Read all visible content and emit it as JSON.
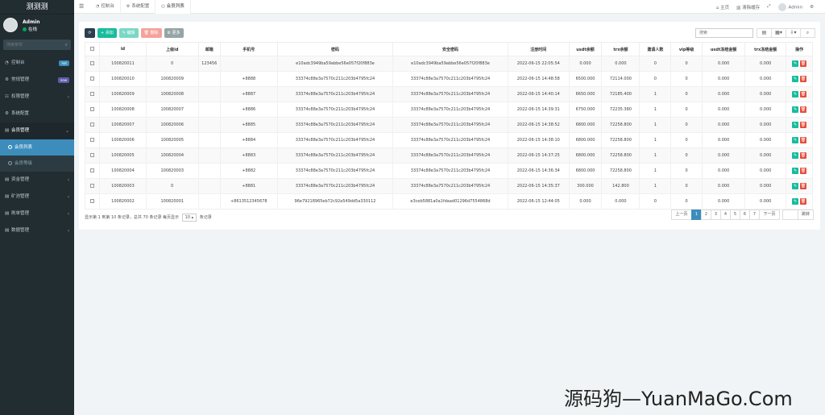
{
  "sidebar": {
    "brand": "测测测",
    "user_name": "Admin",
    "user_status": "在线",
    "search_placeholder": "搜索菜单",
    "menu": [
      {
        "label": "控制台",
        "badge": "hot",
        "badge_color": "#3c8dbc"
      },
      {
        "label": "常规管理",
        "badge": "new",
        "badge_color": "#605ca8"
      },
      {
        "label": "权限管理",
        "arrow": "‹"
      },
      {
        "label": "系统配置"
      },
      {
        "label": "会员管理",
        "arrow": "‹"
      }
    ],
    "submenu": [
      {
        "label": "会员列表"
      },
      {
        "label": "会员等级"
      }
    ],
    "menu2": [
      {
        "label": "资金管理",
        "arrow": "‹"
      },
      {
        "label": "矿池管理",
        "arrow": "‹"
      },
      {
        "label": "刷单管理",
        "arrow": "‹"
      },
      {
        "label": "数据管理",
        "arrow": "‹"
      }
    ]
  },
  "topbar": {
    "tabs": [
      {
        "label": "控制台",
        "icon": "dashboard-icon"
      },
      {
        "label": "系统配置",
        "icon": "gear-icon"
      },
      {
        "label": "会员列表",
        "icon": "circle-icon"
      }
    ],
    "home": "主页",
    "clear_cache": "清除缓存",
    "admin": "Admin"
  },
  "toolbar": {
    "add": "+ 添加",
    "edit": "✎ 编辑",
    "delete": "🗑 删除",
    "more": "⚙ 更多",
    "search_placeholder": "搜索"
  },
  "table": {
    "headers": [
      "id",
      "上级id",
      "邮箱",
      "手机号",
      "密码",
      "安全密码",
      "注册时间",
      "usdt余额",
      "trx余额",
      "邀请人数",
      "vip等级",
      "usdt冻结金额",
      "trx冻结金额",
      "操作"
    ],
    "rows": [
      [
        "100820011",
        "0",
        "123456",
        "",
        "e10adc3949ba59abbe56e057f20f883e",
        "e10adc3949ba59abbe56e057f20f883e",
        "2022-06-15 22:05:54",
        "0.000",
        "0.000",
        "0",
        "0",
        "0.000",
        "0.000"
      ],
      [
        "100820010",
        "100820009",
        "",
        "+8888",
        "33374c88e3a7570c211c203b4795fc24",
        "33374c88e3a7570c211c203b4795fc24",
        "2022-06-15 14:48:58",
        "6500.000",
        "72114.000",
        "0",
        "0",
        "0.000",
        "0.000"
      ],
      [
        "100820009",
        "100820008",
        "",
        "+8887",
        "33374c88e3a7570c211c203b4795fc24",
        "33374c88e3a7570c211c203b4795fc24",
        "2022-06-15 14:40:14",
        "6650.000",
        "72185.400",
        "1",
        "0",
        "0.000",
        "0.000"
      ],
      [
        "100820008",
        "100820007",
        "",
        "+8886",
        "33374c88e3a7570c211c203b4795fc24",
        "33374c88e3a7570c211c203b4795fc24",
        "2022-06-15 14:39:31",
        "6750.000",
        "72235.380",
        "1",
        "0",
        "0.000",
        "0.000"
      ],
      [
        "100820007",
        "100820006",
        "",
        "+8885",
        "33374c88e3a7570c211c203b4795fc24",
        "33374c88e3a7570c211c203b4795fc24",
        "2022-06-15 14:38:52",
        "6800.000",
        "72258.800",
        "1",
        "0",
        "0.000",
        "0.000"
      ],
      [
        "100820006",
        "100820005",
        "",
        "+8884",
        "33374c88e3a7570c211c203b4795fc24",
        "33374c88e3a7570c211c203b4795fc24",
        "2022-06-15 14:38:10",
        "6800.000",
        "72258.800",
        "1",
        "0",
        "0.000",
        "0.000"
      ],
      [
        "100820005",
        "100820004",
        "",
        "+8883",
        "33374c88e3a7570c211c203b4795fc24",
        "33374c88e3a7570c211c203b4795fc24",
        "2022-06-15 14:37:25",
        "6800.000",
        "72258.800",
        "1",
        "0",
        "0.000",
        "0.000"
      ],
      [
        "100820004",
        "100820003",
        "",
        "+8882",
        "33374c88e3a7570c211c203b4795fc24",
        "33374c88e3a7570c211c203b4795fc24",
        "2022-06-15 14:36:34",
        "6800.000",
        "72258.800",
        "1",
        "0",
        "0.000",
        "0.000"
      ],
      [
        "100820003",
        "0",
        "",
        "+8881",
        "33374c88e3a7570c211c203b4795fc24",
        "33374c88e3a7570c211c203b4795fc24",
        "2022-06-15 14:35:37",
        "300.000",
        "142.800",
        "1",
        "0",
        "0.000",
        "0.000"
      ],
      [
        "100820002",
        "100820001",
        "",
        "+8613512345678",
        "96e79218965eb72c92a549dd5a330112",
        "e3ceb5881a0a1fdaad01296d7554868d",
        "2022-06-15 12:44:05",
        "0.000",
        "0.000",
        "0",
        "0",
        "0.000",
        "0.000"
      ]
    ]
  },
  "footer": {
    "info_before": "显示第 1 到第 10 条记录，总共 70 条记录 每页显示",
    "page_size": "10 ▴",
    "info_after": "条记录",
    "prev": "上一页",
    "pages": [
      "1",
      "2",
      "3",
      "4",
      "5",
      "6",
      "7"
    ],
    "active_page": "1",
    "next": "下一页",
    "jump": "跳转"
  },
  "watermark": "源码狗—YuanMaGo.Com"
}
